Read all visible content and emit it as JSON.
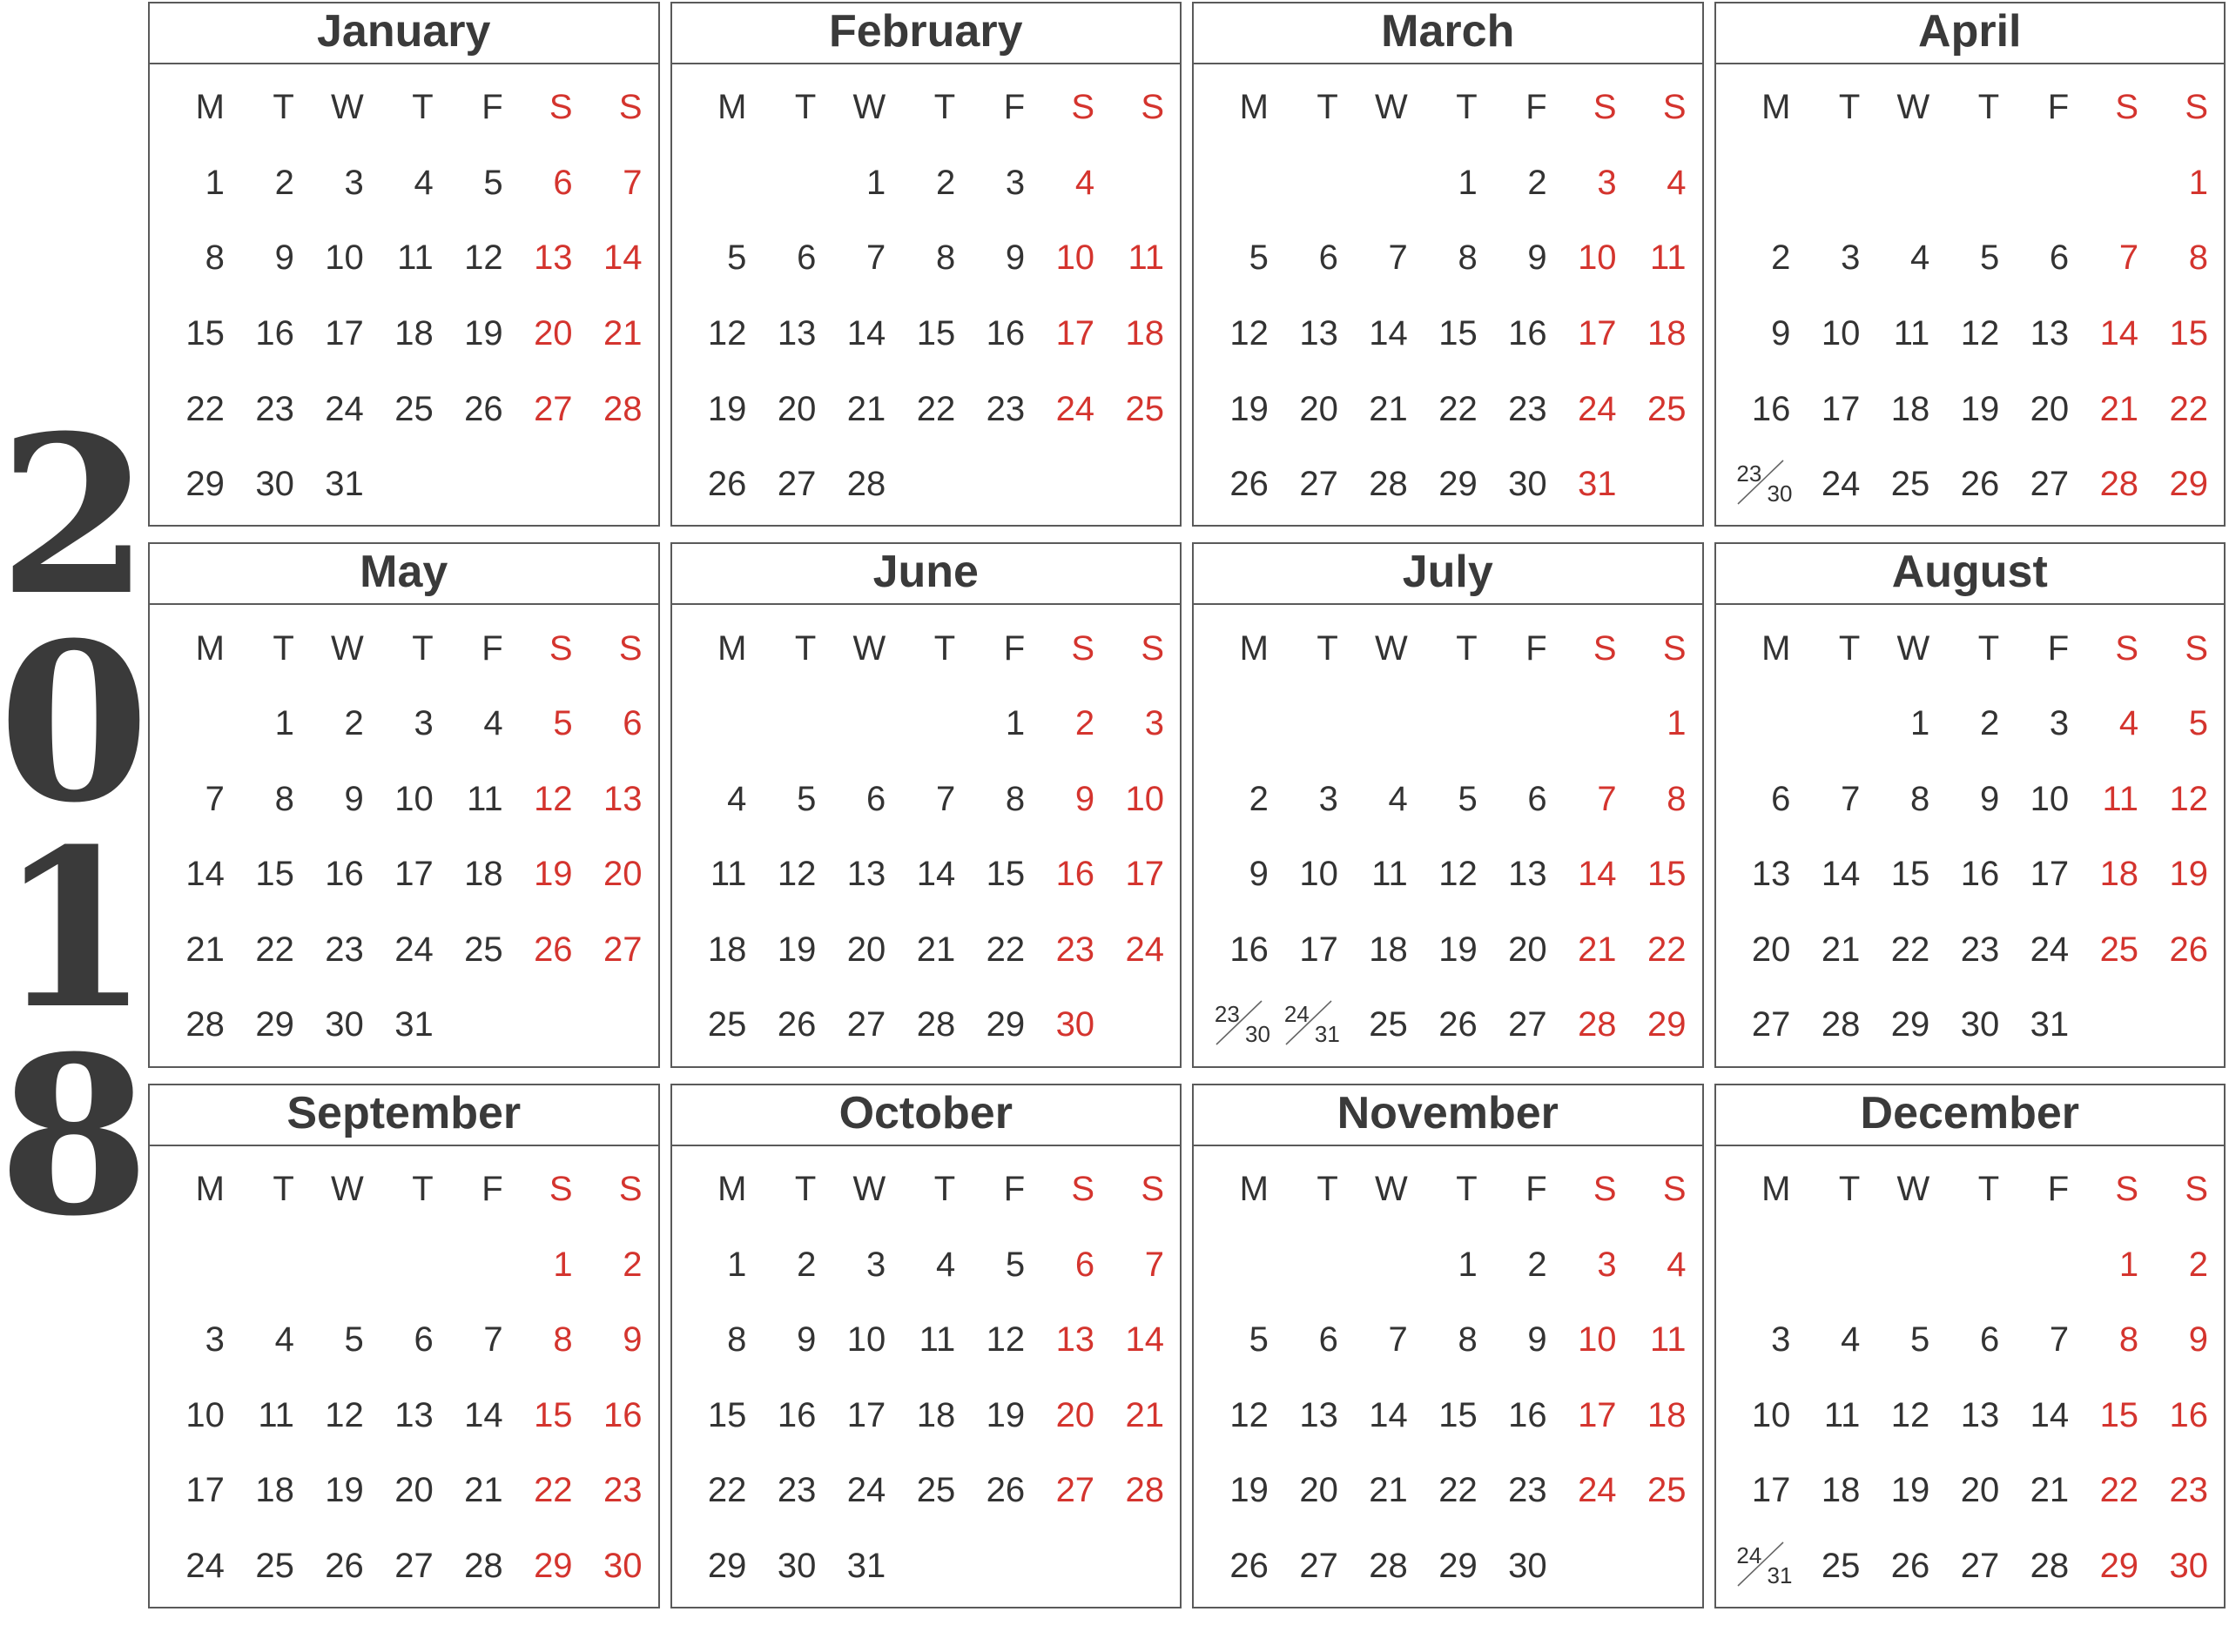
{
  "year": {
    "label": "2018",
    "digits": [
      "2",
      "0",
      "1",
      "8"
    ]
  },
  "colors": {
    "weekend": "#d4342e",
    "text": "#333333",
    "border": "#5a5a5a",
    "year_text": "#3a3a3a",
    "background": "#ffffff"
  },
  "weekday_headers": [
    "M",
    "T",
    "W",
    "T",
    "F",
    "S",
    "S"
  ],
  "weekend_columns": [
    5,
    6
  ],
  "months": [
    {
      "name": "January",
      "weeks": [
        [
          "1",
          "2",
          "3",
          "4",
          "5",
          "6",
          "7"
        ],
        [
          "8",
          "9",
          "10",
          "11",
          "12",
          "13",
          "14"
        ],
        [
          "15",
          "16",
          "17",
          "18",
          "19",
          "20",
          "21"
        ],
        [
          "22",
          "23",
          "24",
          "25",
          "26",
          "27",
          "28"
        ],
        [
          "29",
          "30",
          "31",
          "",
          "",
          "",
          ""
        ]
      ]
    },
    {
      "name": "February",
      "weeks": [
        [
          "",
          "",
          "1",
          "2",
          "3",
          "4"
        ],
        [
          "5",
          "6",
          "7",
          "8",
          "9",
          "10",
          "11"
        ],
        [
          "12",
          "13",
          "14",
          "15",
          "16",
          "17",
          "18"
        ],
        [
          "19",
          "20",
          "21",
          "22",
          "23",
          "24",
          "25"
        ],
        [
          "26",
          "27",
          "28",
          "",
          "",
          "",
          ""
        ]
      ],
      "week_offsets": [
        3
      ]
    },
    {
      "name": "March",
      "weeks": [
        [
          "",
          "",
          "",
          "1",
          "2",
          "3",
          "4"
        ],
        [
          "5",
          "6",
          "7",
          "8",
          "9",
          "10",
          "11"
        ],
        [
          "12",
          "13",
          "14",
          "15",
          "16",
          "17",
          "18"
        ],
        [
          "19",
          "20",
          "21",
          "22",
          "23",
          "24",
          "25"
        ],
        [
          "26",
          "27",
          "28",
          "29",
          "30",
          "31",
          ""
        ]
      ]
    },
    {
      "name": "April",
      "weeks": [
        [
          "",
          "",
          "",
          "",
          "",
          "",
          "1"
        ],
        [
          "2",
          "3",
          "4",
          "5",
          "6",
          "7",
          "8"
        ],
        [
          "9",
          "10",
          "11",
          "12",
          "13",
          "14",
          "15"
        ],
        [
          "16",
          "17",
          "18",
          "19",
          "20",
          "21",
          "22"
        ],
        [
          {
            "split": [
              "23",
              "30"
            ]
          },
          "24",
          "25",
          "26",
          "27",
          "28",
          "29"
        ]
      ]
    },
    {
      "name": "May",
      "weeks": [
        [
          "",
          "1",
          "2",
          "3",
          "4",
          "5",
          "6"
        ],
        [
          "7",
          "8",
          "9",
          "10",
          "11",
          "12",
          "13"
        ],
        [
          "14",
          "15",
          "16",
          "17",
          "18",
          "19",
          "20"
        ],
        [
          "21",
          "22",
          "23",
          "24",
          "25",
          "26",
          "27"
        ],
        [
          "28",
          "29",
          "30",
          "31",
          "",
          "",
          ""
        ]
      ]
    },
    {
      "name": "June",
      "weeks": [
        [
          "",
          "",
          "",
          "",
          "1",
          "2",
          "3"
        ],
        [
          "4",
          "5",
          "6",
          "7",
          "8",
          "9",
          "10"
        ],
        [
          "11",
          "12",
          "13",
          "14",
          "15",
          "16",
          "17"
        ],
        [
          "18",
          "19",
          "20",
          "21",
          "22",
          "23",
          "24"
        ],
        [
          "25",
          "26",
          "27",
          "28",
          "29",
          "30",
          ""
        ]
      ]
    },
    {
      "name": "July",
      "weeks": [
        [
          "",
          "",
          "",
          "",
          "",
          "",
          "1"
        ],
        [
          "2",
          "3",
          "4",
          "5",
          "6",
          "7",
          "8"
        ],
        [
          "9",
          "10",
          "11",
          "12",
          "13",
          "14",
          "15"
        ],
        [
          "16",
          "17",
          "18",
          "19",
          "20",
          "21",
          "22"
        ],
        [
          {
            "split": [
              "23",
              "30"
            ]
          },
          {
            "split": [
              "24",
              "31"
            ]
          },
          "25",
          "26",
          "27",
          "28",
          "29"
        ]
      ]
    },
    {
      "name": "August",
      "weeks": [
        [
          "",
          "",
          "1",
          "2",
          "3",
          "4",
          "5"
        ],
        [
          "6",
          "7",
          "8",
          "9",
          "10",
          "11",
          "12"
        ],
        [
          "13",
          "14",
          "15",
          "16",
          "17",
          "18",
          "19"
        ],
        [
          "20",
          "21",
          "22",
          "23",
          "24",
          "25",
          "26"
        ],
        [
          "27",
          "28",
          "29",
          "30",
          "31",
          "",
          ""
        ]
      ]
    },
    {
      "name": "September",
      "weeks": [
        [
          "",
          "",
          "",
          "",
          "",
          "1",
          "2"
        ],
        [
          "3",
          "4",
          "5",
          "6",
          "7",
          "8",
          "9"
        ],
        [
          "10",
          "11",
          "12",
          "13",
          "14",
          "15",
          "16"
        ],
        [
          "17",
          "18",
          "19",
          "20",
          "21",
          "22",
          "23"
        ],
        [
          "24",
          "25",
          "26",
          "27",
          "28",
          "29",
          "30"
        ]
      ]
    },
    {
      "name": "October",
      "weeks": [
        [
          "1",
          "2",
          "3",
          "4",
          "5",
          "6",
          "7"
        ],
        [
          "8",
          "9",
          "10",
          "11",
          "12",
          "13",
          "14"
        ],
        [
          "15",
          "16",
          "17",
          "18",
          "19",
          "20",
          "21"
        ],
        [
          "22",
          "23",
          "24",
          "25",
          "26",
          "27",
          "28"
        ],
        [
          "29",
          "30",
          "31",
          "",
          "",
          "",
          ""
        ]
      ]
    },
    {
      "name": "November",
      "weeks": [
        [
          "",
          "",
          "",
          "1",
          "2",
          "3",
          "4"
        ],
        [
          "5",
          "6",
          "7",
          "8",
          "9",
          "10",
          "11"
        ],
        [
          "12",
          "13",
          "14",
          "15",
          "16",
          "17",
          "18"
        ],
        [
          "19",
          "20",
          "21",
          "22",
          "23",
          "24",
          "25"
        ],
        [
          "26",
          "27",
          "28",
          "29",
          "30",
          "",
          ""
        ]
      ]
    },
    {
      "name": "December",
      "weeks": [
        [
          "",
          "",
          "",
          "",
          "",
          "1",
          "2"
        ],
        [
          "3",
          "4",
          "5",
          "6",
          "7",
          "8",
          "9"
        ],
        [
          "10",
          "11",
          "12",
          "13",
          "14",
          "15",
          "16"
        ],
        [
          "17",
          "18",
          "19",
          "20",
          "21",
          "22",
          "23"
        ],
        [
          {
            "split": [
              "24",
              "31"
            ]
          },
          "25",
          "26",
          "27",
          "28",
          "29",
          "30"
        ]
      ]
    }
  ]
}
